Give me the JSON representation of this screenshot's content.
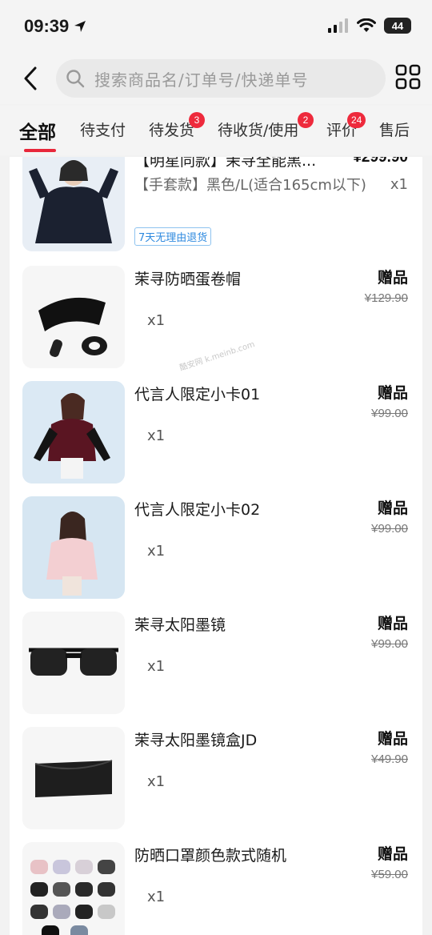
{
  "status": {
    "time": "09:39",
    "battery": "44"
  },
  "search": {
    "placeholder": "搜索商品名/订单号/快递单号"
  },
  "tabs": [
    {
      "label": "全部",
      "active": true
    },
    {
      "label": "待支付"
    },
    {
      "label": "待发货",
      "badge": "3"
    },
    {
      "label": "待收货/使用",
      "badge": "2"
    },
    {
      "label": "评价",
      "badge": "24"
    },
    {
      "label": "售后"
    }
  ],
  "first_item": {
    "title": "【明星同款】茉寻全能黑...",
    "price": "¥299.90",
    "spec": "【手套款】黑色/L(适合165cm以下)",
    "qty": "x1",
    "tag": "7天无理由退货"
  },
  "items": [
    {
      "title": "茉寻防晒蛋卷帽",
      "qty": "x1",
      "label": "赠品",
      "orig_price": "¥129.90",
      "icon": "hat-image"
    },
    {
      "title": "代言人限定小卡01",
      "qty": "x1",
      "label": "赠品",
      "orig_price": "¥99.00",
      "icon": "photocard-image"
    },
    {
      "title": "代言人限定小卡02",
      "qty": "x1",
      "label": "赠品",
      "orig_price": "¥99.00",
      "icon": "photocard-image"
    },
    {
      "title": "茉寻太阳墨镜",
      "qty": "x1",
      "label": "赠品",
      "orig_price": "¥99.00",
      "icon": "sunglasses-image"
    },
    {
      "title": "茉寻太阳墨镜盒JD",
      "qty": "x1",
      "label": "赠品",
      "orig_price": "¥49.90",
      "icon": "case-image"
    },
    {
      "title": "防晒口罩颜色款式随机",
      "qty": "x1",
      "label": "赠品",
      "orig_price": "¥59.00",
      "icon": "mask-image"
    }
  ],
  "watermark": "酷安网 k.meinb.com",
  "colors": {
    "accent": "#e8273a",
    "tag_blue": "#2f8adf"
  }
}
